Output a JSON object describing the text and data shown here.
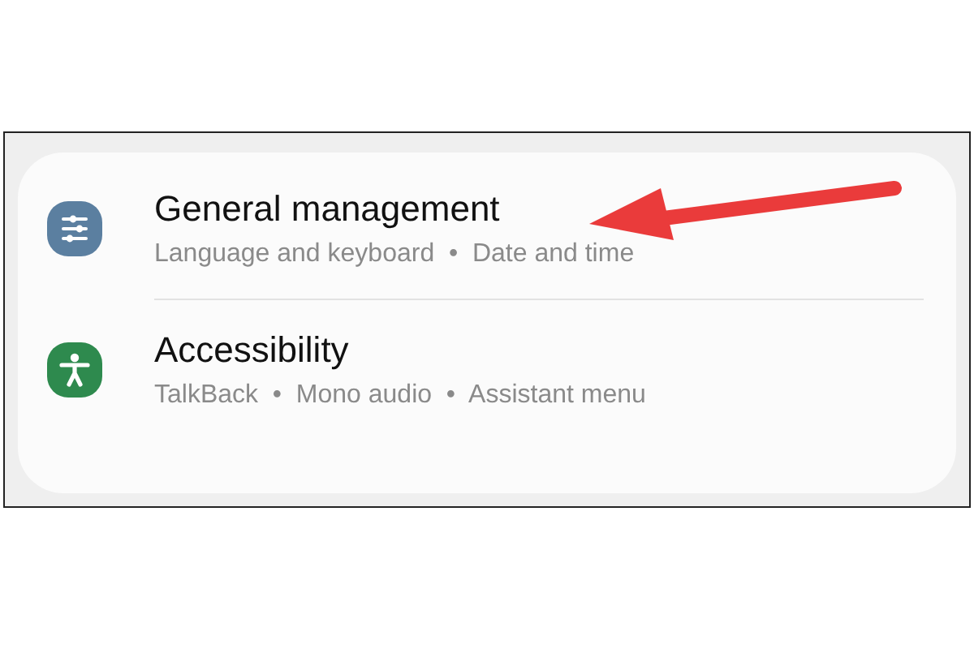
{
  "settings": [
    {
      "title": "General management",
      "subtitle": "Language and keyboard  •  Date and time",
      "kind": "sliders",
      "color": "#5b7fa0"
    },
    {
      "title": "Accessibility",
      "subtitle": "TalkBack  •  Mono audio  •  Assistant menu",
      "kind": "accessibility",
      "color": "#2e8a4e"
    }
  ],
  "annotation": {
    "kind": "arrow"
  }
}
